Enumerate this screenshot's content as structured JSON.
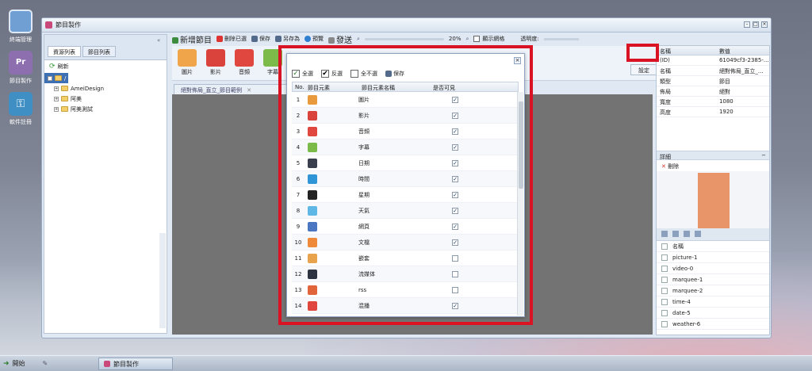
{
  "desktop": {
    "icons": [
      {
        "label": "終端管理",
        "color": "#6f9fd3"
      },
      {
        "label": "節目製作",
        "color": "#8d6fb0"
      },
      {
        "label": "軟件註冊",
        "color": "#3f8fc4"
      }
    ]
  },
  "taskbar": {
    "start": "開始",
    "active_task": "節目製作"
  },
  "window": {
    "title": "節目製作"
  },
  "left_panel": {
    "tabs": [
      "資源列表",
      "節目列表"
    ],
    "refresh": "刷新",
    "tree": [
      "AmeiDesign",
      "阿美",
      "阿美測試"
    ]
  },
  "toolbar": {
    "new_program": "新增節目",
    "delete_selected": "刪除已選",
    "save": "保存",
    "save_as": "另存為",
    "preview": "預覽",
    "publish": "發送",
    "zoom": "20%",
    "show_grid": "顯示網格",
    "transparency": "透明度:"
  },
  "ribbon": {
    "items": [
      "圖片",
      "影片",
      "音頻",
      "字幕"
    ]
  },
  "doc_tab": {
    "label": "絕對佈局_直立_節目範例"
  },
  "settings_button": "設定",
  "properties": {
    "headers": [
      "名稱",
      "數值"
    ],
    "rows": [
      [
        "(ID)",
        "61049cf3-2385-..."
      ],
      [
        "名稱",
        "絕對佈局_直立_..."
      ],
      [
        "類型",
        "節目"
      ],
      [
        "佈局",
        "絕對"
      ],
      [
        "寬度",
        "1080"
      ],
      [
        "高度",
        "1920"
      ]
    ]
  },
  "detail": {
    "title": "詳細",
    "delete": "刪除"
  },
  "elements_list": {
    "header": "名稱",
    "items": [
      "picture-1",
      "video-0",
      "marquee-1",
      "marquee-2",
      "time-4",
      "date-5",
      "weather-6"
    ]
  },
  "dialog": {
    "select_all": "全選",
    "invert": "反選",
    "select_none": "全不選",
    "save": "保存",
    "columns": [
      "No.",
      "節目元素",
      "節目元素名稱",
      "是否可見"
    ],
    "rows": [
      {
        "no": "1",
        "name": "圖片",
        "visible": true,
        "color": "#e89a3c"
      },
      {
        "no": "2",
        "name": "影片",
        "visible": true,
        "color": "#d9433c"
      },
      {
        "no": "3",
        "name": "音頻",
        "visible": true,
        "color": "#e0473f"
      },
      {
        "no": "4",
        "name": "字幕",
        "visible": true,
        "color": "#7cbb4a"
      },
      {
        "no": "5",
        "name": "日期",
        "visible": true,
        "color": "#3a3f4d"
      },
      {
        "no": "6",
        "name": "時間",
        "visible": true,
        "color": "#2f95d6"
      },
      {
        "no": "7",
        "name": "星期",
        "visible": true,
        "color": "#222222"
      },
      {
        "no": "8",
        "name": "天氣",
        "visible": true,
        "color": "#5fb7e6"
      },
      {
        "no": "9",
        "name": "網頁",
        "visible": true,
        "color": "#4b76c2"
      },
      {
        "no": "10",
        "name": "文檔",
        "visible": true,
        "color": "#ee8a3a"
      },
      {
        "no": "11",
        "name": "嵌套",
        "visible": false,
        "color": "#e8a34c"
      },
      {
        "no": "12",
        "name": "流媒体",
        "visible": false,
        "color": "#2d3340"
      },
      {
        "no": "13",
        "name": "rss",
        "visible": false,
        "color": "#e2643a"
      },
      {
        "no": "14",
        "name": "混播",
        "visible": true,
        "color": "#e0463d"
      }
    ]
  }
}
